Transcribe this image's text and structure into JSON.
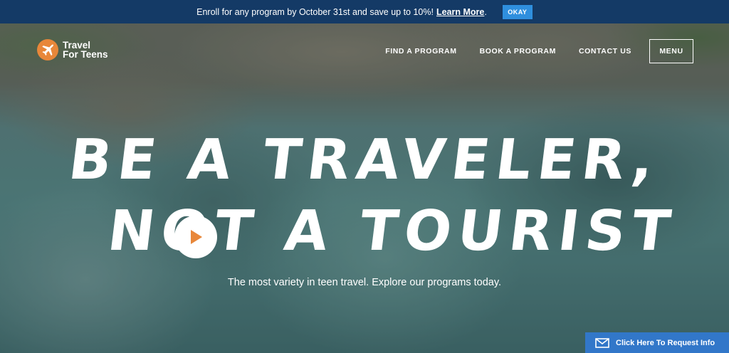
{
  "announcement": {
    "message": "Enroll for any program by October 31st and save up to 10%!",
    "link_label": "Learn More",
    "punctuation": ".",
    "ok_label": "OKAY"
  },
  "logo": {
    "line1": "Travel",
    "line2": "For Teens",
    "icon": "airplane-icon"
  },
  "nav": {
    "items": [
      "FIND A PROGRAM",
      "BOOK A PROGRAM",
      "CONTACT US"
    ],
    "menu_label": "MENU"
  },
  "hero": {
    "headline_line1": "BE A TRAVELER,",
    "headline_line2": "NOT A TOURIST",
    "subheadline": "The most variety in teen travel. Explore our programs today.",
    "play_icon": "play-icon"
  },
  "request_info": {
    "label": "Click Here To Request Info",
    "icon": "envelope-icon"
  },
  "colors": {
    "announcement_bg": "#143a66",
    "ok_button": "#2f8fde",
    "brand_orange": "#e8873a",
    "request_bg": "#3277c9"
  }
}
